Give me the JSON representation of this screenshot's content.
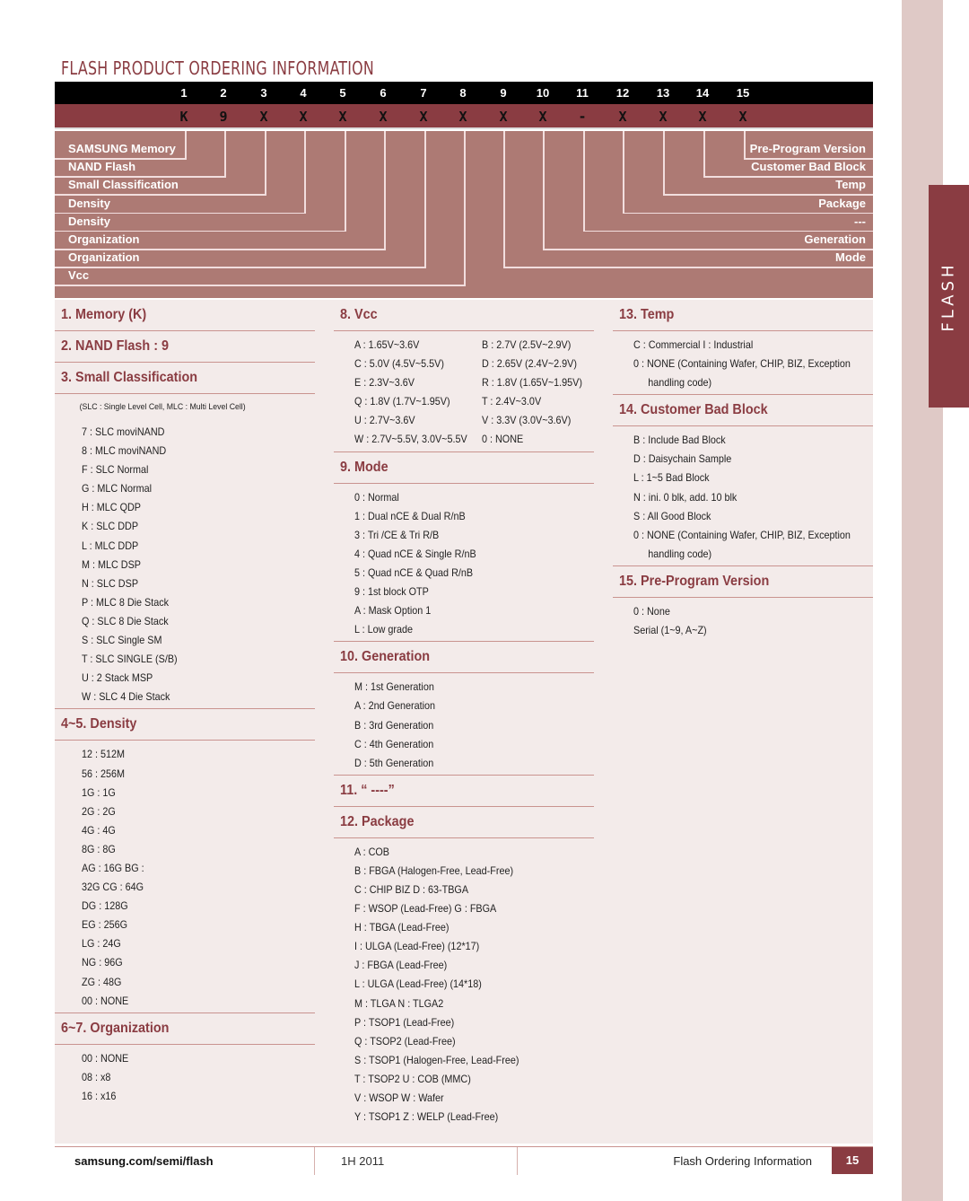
{
  "side_tab": {
    "label": "FLASH"
  },
  "title": "FLASH PRODUCT ORDERING INFORMATION",
  "code_table": {
    "positions": [
      "1",
      "2",
      "3",
      "4",
      "5",
      "6",
      "7",
      "8",
      "9",
      "10",
      "11",
      "12",
      "13",
      "14",
      "15"
    ],
    "codes": [
      "K",
      "9",
      "X",
      "X",
      "X",
      "X",
      "X",
      "X",
      "X",
      "X",
      "-",
      "X",
      "X",
      "X",
      "X"
    ]
  },
  "legend": {
    "left": [
      "SAMSUNG Memory",
      "NAND Flash",
      "Small Classification",
      "Density",
      "Density",
      "Organization",
      "Organization",
      "Vcc"
    ],
    "right": [
      "Pre-Program Version",
      "Customer Bad Block",
      "Temp",
      "Package",
      "---",
      "Generation",
      "Mode"
    ]
  },
  "sections": {
    "memory": {
      "title": "1. Memory (K)"
    },
    "nand": {
      "title": "2. NAND Flash : 9"
    },
    "small_class": {
      "title": "3. Small Classification",
      "note": "(SLC : Single Level Cell, MLC : Multi Level Cell)",
      "items": [
        "7 : SLC moviNAND",
        "8 : MLC moviNAND",
        "F : SLC Normal",
        "G : MLC Normal",
        "H : MLC QDP",
        "K : SLC DDP",
        "L : MLC DDP",
        "M : MLC DSP",
        "N : SLC DSP",
        "P : MLC 8 Die Stack",
        "Q : SLC 8 Die Stack",
        "S : SLC Single SM",
        "T : SLC SINGLE (S/B)",
        "U : 2 Stack MSP",
        "W : SLC 4 Die Stack"
      ]
    },
    "density": {
      "title": "4~5. Density",
      "items": [
        "12 : 512M",
        "56 : 256M",
        "1G : 1G",
        "2G : 2G",
        "4G : 4G",
        "8G : 8G",
        "AG : 16G BG :",
        "32G CG : 64G",
        "DG : 128G",
        "EG : 256G",
        "LG : 24G",
        "NG : 96G",
        "ZG : 48G",
        "00 : NONE"
      ]
    },
    "organization": {
      "title": "6~7. Organization",
      "items": [
        "00 : NONE",
        "08 : x8",
        "16 : x16"
      ]
    },
    "vcc": {
      "title": "8. Vcc",
      "items": [
        "A : 1.65V~3.6V",
        "B : 2.7V (2.5V~2.9V)",
        "C : 5.0V (4.5V~5.5V)",
        "D : 2.65V (2.4V~2.9V)",
        "E : 2.3V~3.6V",
        "R : 1.8V (1.65V~1.95V)",
        "Q : 1.8V (1.7V~1.95V)",
        "T : 2.4V~3.0V",
        "U : 2.7V~3.6V",
        "V : 3.3V (3.0V~3.6V)",
        "W : 2.7V~5.5V, 3.0V~5.5V",
        "0 : NONE"
      ]
    },
    "mode": {
      "title": "9. Mode",
      "items": [
        "0 : Normal",
        "1 : Dual nCE & Dual R/nB",
        "3 : Tri /CE & Tri R/B",
        "4 : Quad nCE & Single R/nB",
        "5 : Quad nCE & Quad R/nB",
        "9 : 1st block OTP",
        "A : Mask Option 1",
        "L : Low grade"
      ]
    },
    "generation": {
      "title": "10. Generation",
      "items": [
        "M : 1st Generation",
        "A : 2nd Generation",
        "B : 3rd Generation",
        "C : 4th Generation",
        "D : 5th Generation"
      ]
    },
    "dash": {
      "title": "11. “ ----”"
    },
    "package": {
      "title": "12. Package",
      "items": [
        "A : COB",
        "B : FBGA (Halogen-Free, Lead-Free)",
        "C : CHIP BIZ D : 63-TBGA",
        "F : WSOP (Lead-Free) G : FBGA",
        "H : TBGA (Lead-Free)",
        "I : ULGA (Lead-Free) (12*17)",
        "J : FBGA (Lead-Free)",
        "L : ULGA (Lead-Free) (14*18)",
        "M : TLGA N : TLGA2",
        "P : TSOP1 (Lead-Free)",
        "Q : TSOP2 (Lead-Free)",
        "S : TSOP1 (Halogen-Free, Lead-Free)",
        "T : TSOP2 U : COB (MMC)",
        "V : WSOP W : Wafer",
        "Y : TSOP1 Z : WELP (Lead-Free)"
      ]
    },
    "temp": {
      "title": "13. Temp",
      "items": [
        "C : Commercial I : Industrial",
        "0 : NONE (Containing Wafer, CHIP, BIZ, Exception",
        "handling code)"
      ]
    },
    "bad_block": {
      "title": "14. Customer Bad Block",
      "items": [
        "B : Include Bad Block",
        "D : Daisychain Sample",
        "L : 1~5 Bad Block",
        "N : ini. 0 blk, add. 10 blk",
        "S :  All Good Block",
        "0 : NONE (Containing Wafer, CHIP, BIZ, Exception",
        "handling code)"
      ]
    },
    "pre_program": {
      "title": "15. Pre-Program Version",
      "items": [
        "0 : None",
        "Serial (1~9, A~Z)"
      ]
    }
  },
  "footer": {
    "url": "samsung.com/semi/flash",
    "period": "1H 2011",
    "title": "Flash Ordering Information",
    "page": "15"
  }
}
